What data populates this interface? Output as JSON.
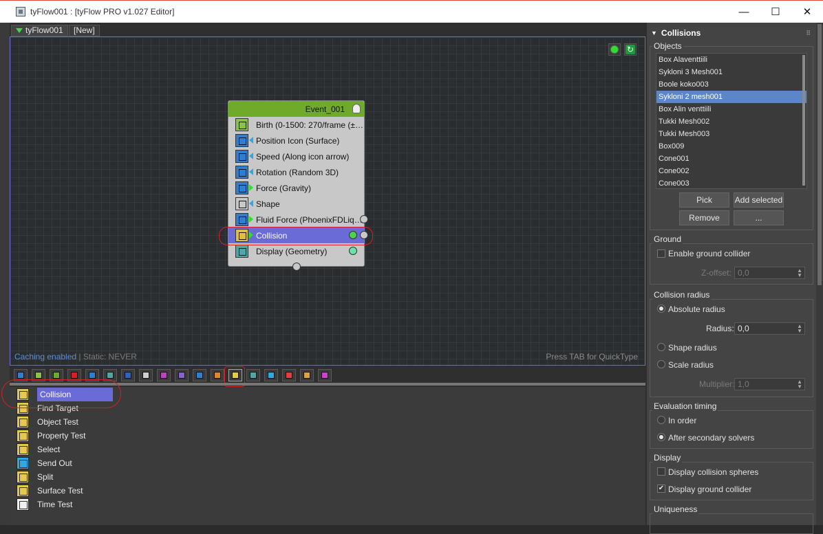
{
  "window": {
    "title": "tyFlow001 : [tyFlow PRO v1.027 Editor]",
    "controls": [
      "—",
      "☐",
      "✕"
    ]
  },
  "tabs": [
    {
      "label": "tyFlow001"
    },
    {
      "label": "[New]"
    }
  ],
  "canvas": {
    "status_caching": "Caching enabled",
    "status_static": " | Static: NEVER",
    "hint": "Press TAB for QuickType"
  },
  "event": {
    "name": "Event_001",
    "operators": [
      {
        "label": "Birth (0-1500: 270/frame (±…"
      },
      {
        "label": "Position Icon (Surface)"
      },
      {
        "label": "Speed (Along icon arrow)"
      },
      {
        "label": "Rotation (Random 3D)"
      },
      {
        "label": "Force (Gravity)"
      },
      {
        "label": "Shape"
      },
      {
        "label": "Fluid Force (PhoenixFDLiq…"
      },
      {
        "label": "Collision"
      },
      {
        "label": "Display (Geometry)"
      }
    ]
  },
  "operator_list": {
    "items": [
      {
        "label": "Collision"
      },
      {
        "label": "Find Target"
      },
      {
        "label": "Object Test"
      },
      {
        "label": "Property Test"
      },
      {
        "label": "Select"
      },
      {
        "label": "Send Out"
      },
      {
        "label": "Split"
      },
      {
        "label": "Surface Test"
      },
      {
        "label": "Time Test"
      }
    ]
  },
  "panel": {
    "title": "Collisions",
    "objects_label": "Objects",
    "objects": [
      "Box Alaventtiili",
      "Sykloni 3 Mesh001",
      "Boole koko003",
      "Sykloni 2 mesh001",
      "Box Alin venttiili",
      "Tukki Mesh002",
      "Tukki Mesh003",
      "Box009",
      "Cone001",
      "Cone002",
      "Cone003"
    ],
    "buttons": {
      "pick": "Pick",
      "add_selected": "Add selected",
      "remove": "Remove",
      "more": "..."
    },
    "ground": {
      "title": "Ground",
      "enable_label": "Enable ground collider",
      "zoffset_label": "Z-offset:",
      "zoffset_value": "0,0"
    },
    "radius": {
      "title": "Collision radius",
      "absolute_label": "Absolute radius",
      "radius_label": "Radius:",
      "radius_value": "0,0",
      "shape_label": "Shape radius",
      "scale_label": "Scale radius",
      "multiplier_label": "Multiplier:",
      "multiplier_value": "1,0"
    },
    "timing": {
      "title": "Evaluation timing",
      "in_order_label": "In order",
      "after_label": "After secondary solvers"
    },
    "display": {
      "title": "Display",
      "spheres_label": "Display collision spheres",
      "ground_label": "Display ground collider",
      "ground_check": "✔"
    },
    "uniqueness": {
      "title": "Uniqueness"
    }
  },
  "colors": {
    "selection": "#6b6bd8",
    "event_header": "#6faa2a",
    "list_selection": "#5b86c8",
    "annotation": "#d62020"
  }
}
